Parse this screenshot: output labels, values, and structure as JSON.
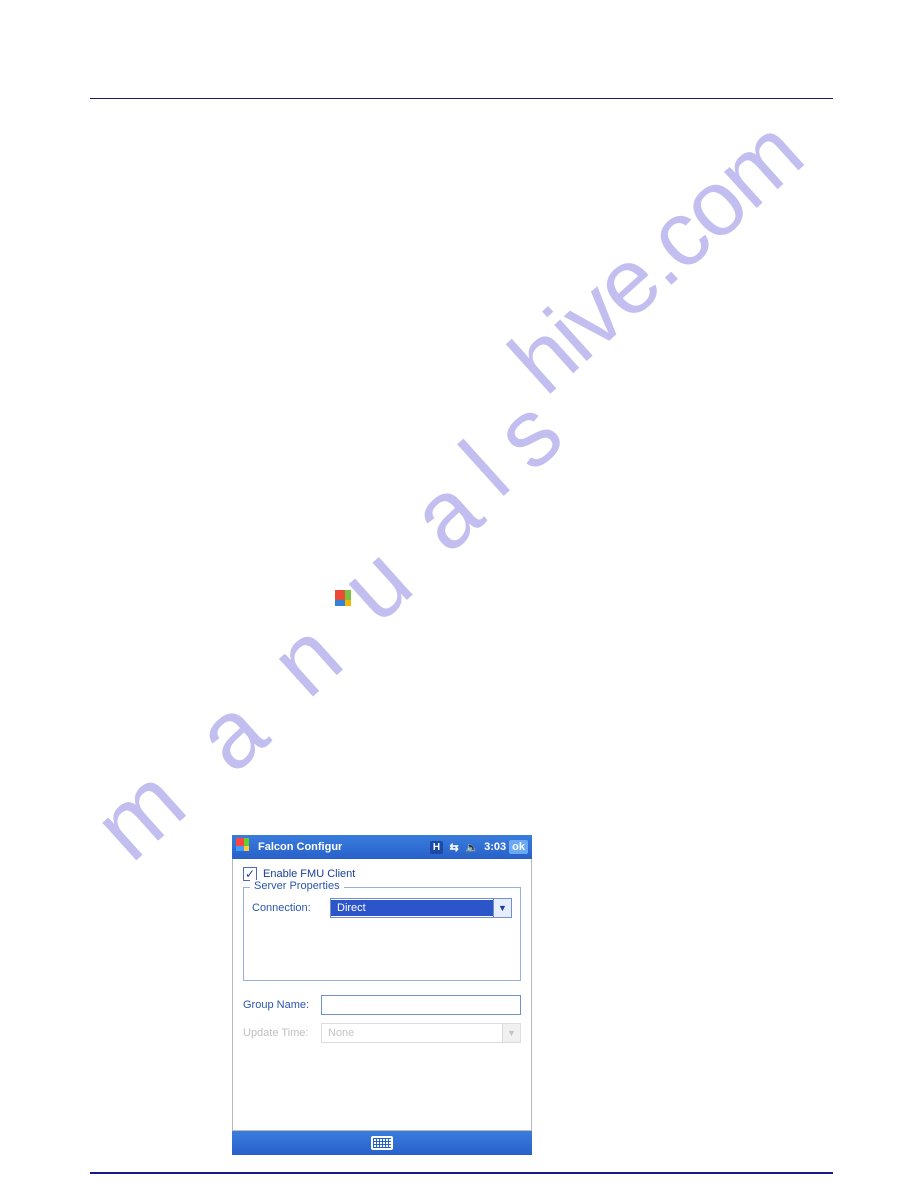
{
  "watermark": {
    "c1": "m",
    "c2": "a",
    "c3": "n",
    "c4": "u",
    "c5": "a",
    "c6": "l",
    "c7": "s",
    "c8": "hive.com"
  },
  "device": {
    "titlebar": {
      "title": "Falcon Configur",
      "badge": "H",
      "time": "3:03",
      "ok": "ok"
    },
    "enable_label": "Enable FMU Client",
    "server_legend": "Server Properties",
    "connection_label": "Connection:",
    "connection_value": "Direct",
    "group_label": "Group Name:",
    "group_value": "",
    "update_label": "Update Time:",
    "update_value": "None"
  }
}
